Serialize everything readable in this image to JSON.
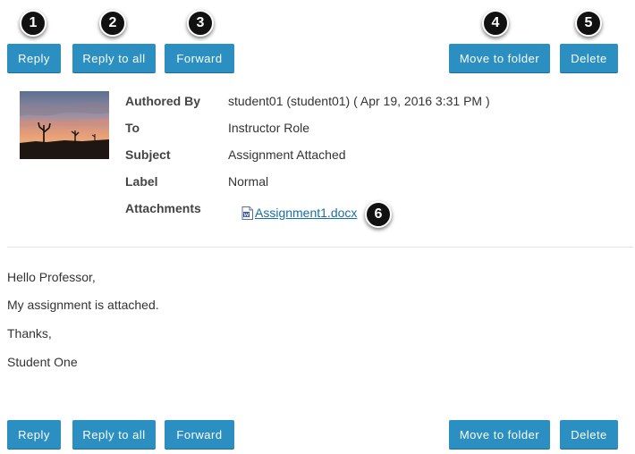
{
  "toolbar_top": {
    "reply": "Reply",
    "reply_all": "Reply to all",
    "forward": "Forward",
    "move": "Move to folder",
    "delete": "Delete"
  },
  "toolbar_bottom": {
    "reply": "Reply",
    "reply_all": "Reply to all",
    "forward": "Forward",
    "move": "Move to folder",
    "delete": "Delete"
  },
  "badges": [
    "1",
    "2",
    "3",
    "4",
    "5",
    "6"
  ],
  "message": {
    "labels": {
      "authored_by": "Authored By",
      "to": "To",
      "subject": "Subject",
      "label": "Label",
      "attachments": "Attachments"
    },
    "authored_by": "student01 (student01) ( Apr 19, 2016 3:31 PM )",
    "to": "Instructor Role",
    "subject": "Assignment Attached",
    "label": "Normal",
    "attachment_name": "Assignment1.docx",
    "attachment_icon": "word-doc-icon",
    "body": [
      "Hello Professor,",
      "My assignment is attached.",
      "Thanks,",
      "Student One"
    ]
  },
  "colors": {
    "button": "#2b8fc2",
    "link": "#1a6ea8",
    "badge": "#111111"
  }
}
